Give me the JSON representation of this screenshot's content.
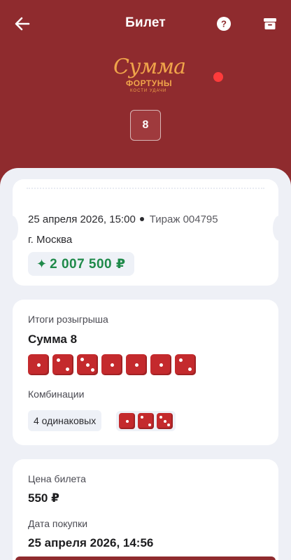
{
  "header": {
    "title": "Билет",
    "back_icon": "arrow-left-icon",
    "help_icon": "question-circle-icon",
    "archive_icon": "archive-icon"
  },
  "logo": {
    "main": "Сумма",
    "sub": "ФОРТУНЫ",
    "tag": "КОСТИ УДАЧИ"
  },
  "ticket_number": "8",
  "ticket": {
    "date": "25 апреля 2026, 15:00",
    "draw": "Тираж 004795",
    "city": "г. Москва",
    "win_amount": "2 007 500 ₽",
    "win_icon": "sparkle-icon"
  },
  "results": {
    "label": "Итоги розыгрыша",
    "sum": "Сумма 8",
    "dice_values": [
      1,
      2,
      3,
      1,
      1,
      1,
      2
    ],
    "combos_label": "Комбинации",
    "combo_text": "4 одинаковых",
    "combo_dice": [
      1,
      2,
      3
    ]
  },
  "purchase": {
    "price_label": "Цена билета",
    "price": "550 ₽",
    "date_label": "Дата покупки",
    "date": "25 апреля 2026, 14:56"
  },
  "colors": {
    "brand": "#8f2b2e",
    "win_green": "#1f8a4a",
    "dice_red": "#c42a2d",
    "logo_orange": "#f0a44a"
  }
}
